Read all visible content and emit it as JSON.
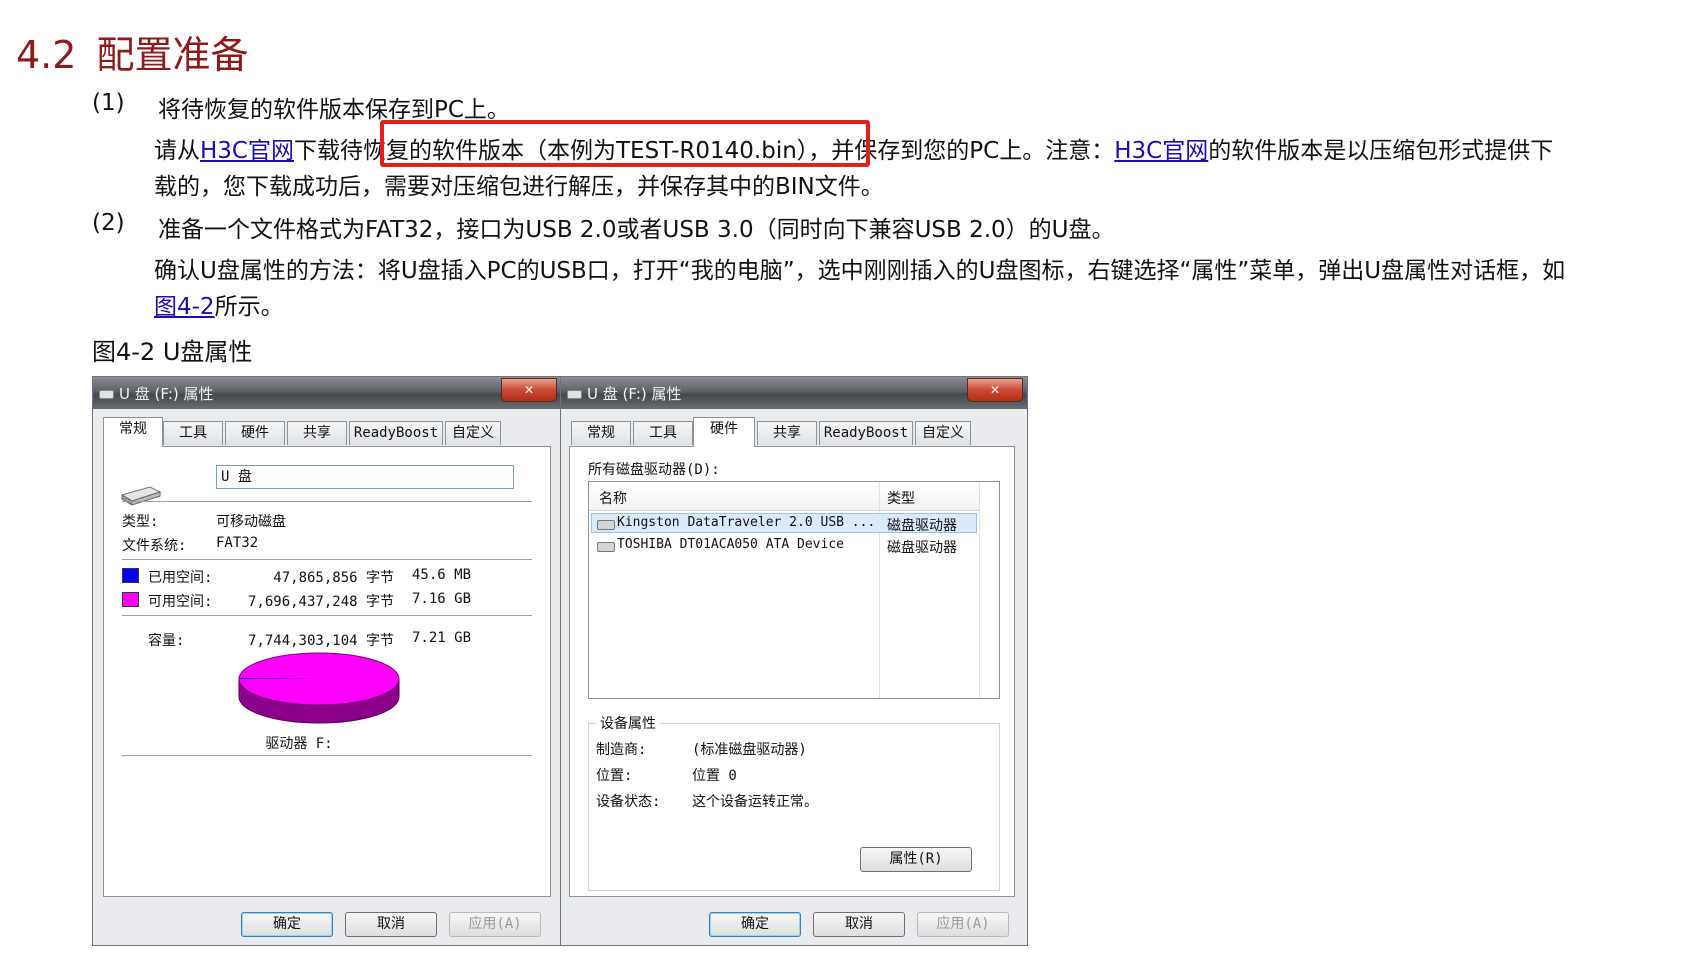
{
  "heading": {
    "number": "4.2",
    "title": "配置准备"
  },
  "steps": [
    {
      "index": "(1)",
      "text": "将待恢复的软件版本保存到PC上。",
      "detail_prefix": "请从",
      "link1": "H3C官网",
      "detail_mid": "下载待恢复的软件版本（本例为TEST-R0140.bin），并保存到您的PC上。注意：",
      "link2": "H3C官网",
      "detail_suffix": "的软件版本是以压缩包形式提供下",
      "detail_line2": "载的，您下载成功后，需要对压缩包进行解压，并保存其中的BIN文件。"
    },
    {
      "index": "(2)",
      "text": "准备一个文件格式为FAT32，接口为USB 2.0或者USB 3.0（同时向下兼容USB 2.0）的U盘。",
      "detail_line1": "确认U盘属性的方法：将U盘插入PC的USB口，打开“我的电脑”，选中刚刚插入的U盘图标，右键选择“属性”菜单，弹出U盘属性对话框，如",
      "link": "图4-2",
      "detail_line2_suffix": "所示。"
    }
  ],
  "figure_caption": "图4-2 U盘属性",
  "dialog_left": {
    "title": "U 盘 (F:) 属性",
    "close": "✕",
    "tabs": [
      "常规",
      "工具",
      "硬件",
      "共享",
      "ReadyBoost",
      "自定义"
    ],
    "active_tab": 0,
    "volume_label": "U 盘",
    "type_label": "类型:",
    "type_value": "可移动磁盘",
    "fs_label": "文件系统:",
    "fs_value": "FAT32",
    "used_label": "已用空间:",
    "used_bytes": "47,865,856 字节",
    "used_size": "45.6 MB",
    "free_label": "可用空间:",
    "free_bytes": "7,696,437,248 字节",
    "free_size": "7.16 GB",
    "capacity_label": "容量:",
    "capacity_bytes": "7,744,303,104 字节",
    "capacity_size": "7.21 GB",
    "drive_label": "驱动器 F:",
    "used_color": "#0000ff",
    "free_color": "#ff00ff",
    "used_fraction": 0.0062,
    "buttons": [
      "确定",
      "取消",
      "应用(A)"
    ]
  },
  "dialog_right": {
    "title": "U 盘 (F:) 属性",
    "close": "✕",
    "tabs": [
      "常规",
      "工具",
      "硬件",
      "共享",
      "ReadyBoost",
      "自定义"
    ],
    "active_tab": 2,
    "list_label": "所有磁盘驱动器(D):",
    "col_name": "名称",
    "col_type": "类型",
    "rows": [
      {
        "name": "Kingston DataTraveler 2.0 USB ...",
        "type": "磁盘驱动器"
      },
      {
        "name": "TOSHIBA DT01ACA050 ATA Device",
        "type": "磁盘驱动器"
      }
    ],
    "props_group": "设备属性",
    "mfr_label": "制造商:",
    "mfr_value": "(标准磁盘驱动器)",
    "loc_label": "位置:",
    "loc_value": "位置 0",
    "status_label": "设备状态:",
    "status_value": "这个设备运转正常。",
    "props_button": "属性(R)",
    "buttons": [
      "确定",
      "取消",
      "应用(A)"
    ]
  }
}
